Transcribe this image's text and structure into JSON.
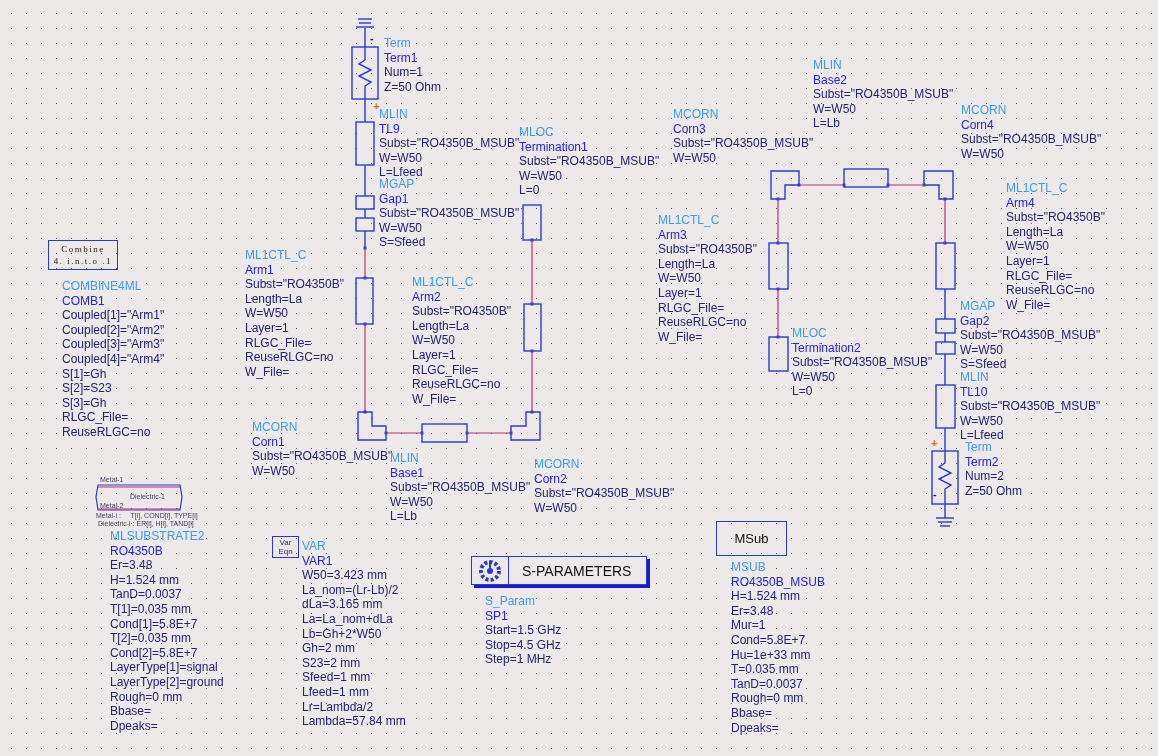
{
  "components": [
    {
      "type": "Term",
      "name": "Term1",
      "params": [
        "Num=1",
        "Z=50 Ohm"
      ],
      "terminal_marks": [
        "-",
        "+"
      ]
    },
    {
      "type": "MLIN",
      "name": "TL9",
      "params": [
        "Subst=\"RO4350B_MSUB\"",
        "W=W50",
        "L=Lfeed"
      ]
    },
    {
      "type": "MLOC",
      "name": "Termination1",
      "params": [
        "Subst=\"RO4350B_MSUB\"",
        "W=W50",
        "L=0"
      ]
    },
    {
      "type": "MGAP",
      "name": "Gap1",
      "params": [
        "Subst=\"RO4350B_MSUB\"",
        "W=W50",
        "S=Sfeed"
      ]
    },
    {
      "type": "COMBINE4ML",
      "name": "COMB1",
      "params": [
        "Coupled[1]=\"Arm1\"",
        "Coupled[2]=\"Arm2\"",
        "Coupled[3]=\"Arm3\"",
        "Coupled[4]=\"Arm4\"",
        "S[1]=Gh",
        "S[2]=S23",
        "S[3]=Gh",
        "RLGC_File=",
        "ReuseRLGC=no"
      ]
    },
    {
      "type": "ML1CTL_C",
      "name": "Arm1",
      "params": [
        "Subst=\"RO4350B\"",
        "Length=La",
        "W=W50",
        "Layer=1",
        "RLGC_File=",
        "ReuseRLGC=no",
        "W_File="
      ]
    },
    {
      "type": "ML1CTL_C",
      "name": "Arm2",
      "params": [
        "Subst=\"RO4350B\"",
        "Length=La",
        "W=W50",
        "Layer=1",
        "RLGC_File=",
        "ReuseRLGC=no",
        "W_File="
      ]
    },
    {
      "type": "MCORN",
      "name": "Corn1",
      "params": [
        "Subst=\"RO4350B_MSUB\"",
        "W=W50"
      ]
    },
    {
      "type": "MLIN",
      "name": "Base1",
      "params": [
        "Subst=\"RO4350B_MSUB\"",
        "W=W50",
        "L=Lb"
      ]
    },
    {
      "type": "MCORN",
      "name": "Corn2",
      "params": [
        "Subst=\"RO4350B_MSUB\"",
        "W=W50"
      ]
    },
    {
      "type": "MLIN",
      "name": "Base2",
      "params": [
        "Subst=\"RO4350B_MSUB\"",
        "W=W50",
        "L=Lb"
      ]
    },
    {
      "type": "MCORN",
      "name": "Corn3",
      "params": [
        "Subst=\"RO4350B_MSUB\"",
        "W=W50"
      ]
    },
    {
      "type": "MCORN",
      "name": "Corn4",
      "params": [
        "Subst=\"RO4350B_MSUB\"",
        "W=W50"
      ]
    },
    {
      "type": "ML1CTL_C",
      "name": "Arm4",
      "params": [
        "Subst=\"RO4350B\"",
        "Length=La",
        "W=W50",
        "Layer=1",
        "RLGC_File=",
        "ReuseRLGC=no",
        "W_File="
      ]
    },
    {
      "type": "ML1CTL_C",
      "name": "Arm3",
      "params": [
        "Subst=\"RO4350B\"",
        "Length=La",
        "W=W50",
        "Layer=1",
        "RLGC_File=",
        "ReuseRLGC=no",
        "W_File="
      ]
    },
    {
      "type": "MGAP",
      "name": "Gap2",
      "params": [
        "Subst=\"RO4350B_MSUB\"",
        "W=W50",
        "S=Sfeed"
      ]
    },
    {
      "type": "MLOC",
      "name": "Termination2",
      "params": [
        "Subst=\"RO4350B_MSUB\"",
        "W=W50",
        "L=0"
      ]
    },
    {
      "type": "MLIN",
      "name": "TL10",
      "params": [
        "Subst=\"RO4350B_MSUB\"",
        "W=W50",
        "L=Lfeed"
      ]
    },
    {
      "type": "Term",
      "name": "Term2",
      "params": [
        "Num=2",
        "Z=50 Ohm"
      ],
      "terminal_marks": [
        "+",
        "-"
      ]
    },
    {
      "type": "MLSUBSTRATE2",
      "name": "RO4350B",
      "params": [
        "Er=3.48",
        "H=1.524 mm",
        "TanD=0.0037",
        "T[1]=0.035 mm",
        "Cond[1]=5.8E+7",
        "T[2]=0.035 mm",
        "Cond[2]=5.8E+7",
        "LayerType[1]=signal",
        "LayerType[2]=ground",
        "Rough=0 mm",
        "Bbase=",
        "Dpeaks="
      ]
    },
    {
      "type": "VAR",
      "name": "VAR1",
      "params": [
        "W50=3.423 mm",
        "La_nom=(Lr-Lb)/2",
        "dLa=3.165 mm",
        "La=La_nom+dLa",
        "Lb=Gh+2*W50",
        "Gh=2 mm",
        "S23=2 mm",
        "Sfeed=1 mm",
        "Lfeed=1 mm",
        "Lr=Lambda/2",
        "Lambda=57.84 mm"
      ]
    },
    {
      "type": "S_Param",
      "name": "SP1",
      "params": [
        "Start=1.5 GHz",
        "Stop=4.5 GHz",
        "Step=1 MHz"
      ]
    },
    {
      "type": "MSUB",
      "name": "RO4350B_MSUB",
      "params": [
        "H=1.524 mm",
        "Er=3.48",
        "Mur=1",
        "Cond=5.8E+7",
        "Hu=1e+33 mm",
        "T=0.035 mm",
        "TanD=0.0037",
        "Rough=0 mm",
        "Bbase=",
        "Dpeaks="
      ]
    }
  ],
  "combine_box": {
    "lines": [
      "Combine",
      "4. i.n.t.o .1"
    ]
  },
  "substrate_drawing": {
    "labels": [
      "Metal-1",
      "Dielectric-1",
      "Metal-2",
      "Metal-i :     T[i], COND[i], TYPE[i]",
      "Dielectric-i : ER[i], H[i], TAND[i]"
    ]
  },
  "var_icon": {
    "lines": [
      "Var",
      "Eqn"
    ]
  },
  "s_parameters_block": {
    "label": "S-PARAMETERS"
  },
  "msub_box": {
    "label": "MSub"
  }
}
